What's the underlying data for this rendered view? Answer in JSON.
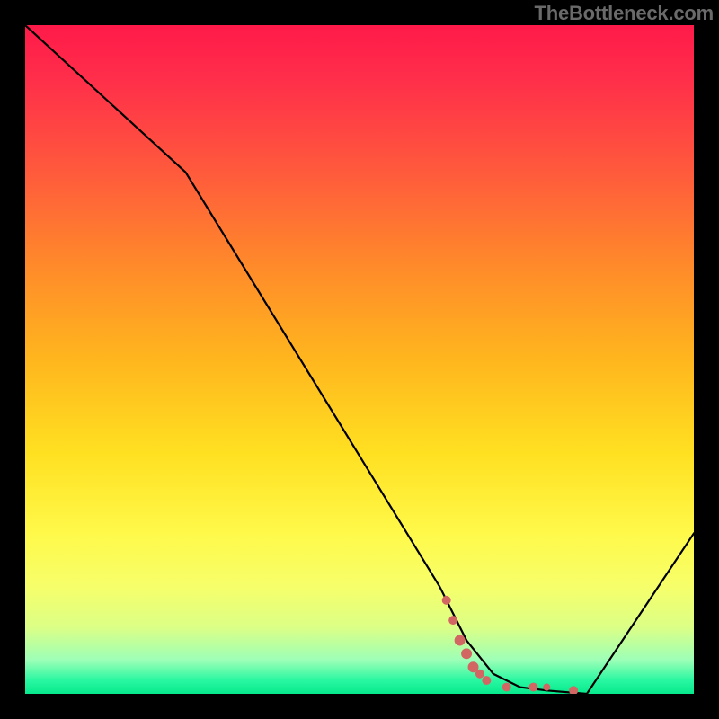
{
  "watermark": "TheBottleneck.com",
  "chart_data": {
    "type": "line",
    "title": "",
    "xlabel": "",
    "ylabel": "",
    "xlim": [
      0,
      100
    ],
    "ylim": [
      0,
      100
    ],
    "grid": false,
    "legend": false,
    "series": [
      {
        "name": "bottleneck-curve",
        "x": [
          0,
          24,
          62,
          66,
          70,
          74,
          78,
          84,
          100
        ],
        "y": [
          100,
          78,
          16,
          8,
          3,
          1,
          0.5,
          0,
          24
        ]
      }
    ],
    "markers": {
      "name": "highlight-points",
      "color": "#d26663",
      "points": [
        {
          "x": 63,
          "y": 14,
          "r": 5
        },
        {
          "x": 64,
          "y": 11,
          "r": 5
        },
        {
          "x": 65,
          "y": 8,
          "r": 6
        },
        {
          "x": 66,
          "y": 6,
          "r": 6
        },
        {
          "x": 67,
          "y": 4,
          "r": 6
        },
        {
          "x": 68,
          "y": 3,
          "r": 5
        },
        {
          "x": 69,
          "y": 2,
          "r": 5
        },
        {
          "x": 72,
          "y": 1,
          "r": 5
        },
        {
          "x": 76,
          "y": 1,
          "r": 5
        },
        {
          "x": 78,
          "y": 1,
          "r": 4
        },
        {
          "x": 82,
          "y": 0.5,
          "r": 5
        }
      ]
    },
    "gradient_stops": [
      {
        "pos": 0,
        "color": "#ff1a49"
      },
      {
        "pos": 8,
        "color": "#ff2e4a"
      },
      {
        "pos": 22,
        "color": "#ff5a3c"
      },
      {
        "pos": 36,
        "color": "#ff8a2a"
      },
      {
        "pos": 50,
        "color": "#ffb61e"
      },
      {
        "pos": 64,
        "color": "#ffe021"
      },
      {
        "pos": 76,
        "color": "#fff94a"
      },
      {
        "pos": 84,
        "color": "#f6ff6a"
      },
      {
        "pos": 90,
        "color": "#dcff86"
      },
      {
        "pos": 95,
        "color": "#9cffb7"
      },
      {
        "pos": 98,
        "color": "#28f7a1"
      },
      {
        "pos": 100,
        "color": "#07e98c"
      }
    ]
  }
}
